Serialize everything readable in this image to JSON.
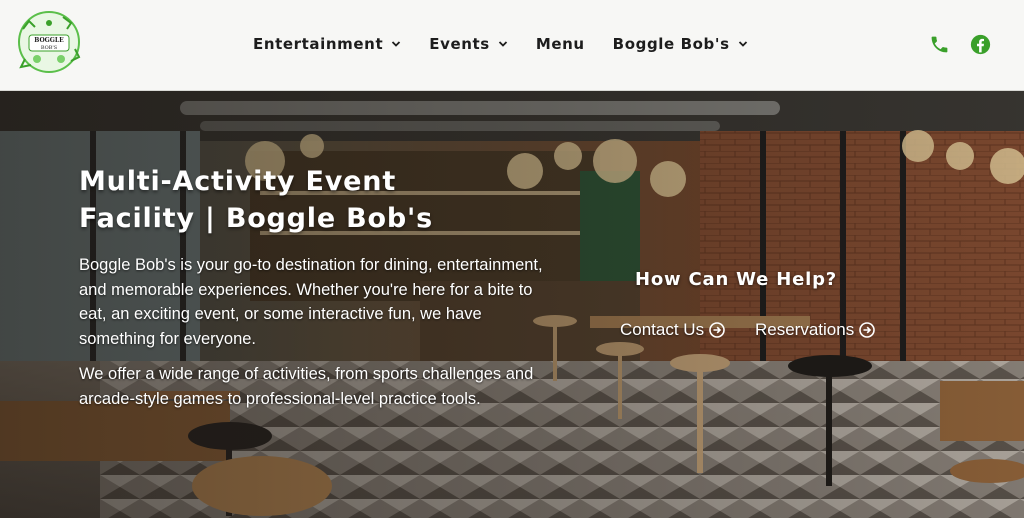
{
  "header": {
    "logo": {
      "text_top": "BOGGLE",
      "text_bottom": "BOB'S"
    },
    "nav": [
      {
        "label": "Entertainment",
        "has_dropdown": true
      },
      {
        "label": "Events",
        "has_dropdown": true
      },
      {
        "label": "Menu",
        "has_dropdown": false
      },
      {
        "label": "Boggle Bob's",
        "has_dropdown": true
      }
    ],
    "icons": {
      "phone": "phone-icon",
      "facebook": "facebook-icon"
    },
    "accent_color": "#3aa02a"
  },
  "hero": {
    "title_line1": "Multi-Activity Event",
    "title_line2": "Facility | Boggle Bob's",
    "paragraph1": "Boggle Bob's is your go-to destination for dining, entertainment, and memorable experiences. Whether you're here for a bite to eat, an exciting event, or some interactive fun, we have something for everyone.",
    "paragraph2": "We offer a wide range of activities, from sports challenges and arcade-style games to professional-level practice tools.",
    "help_title": "How Can We Help?",
    "contact_label": "Contact Us",
    "reservations_label": "Reservations"
  }
}
